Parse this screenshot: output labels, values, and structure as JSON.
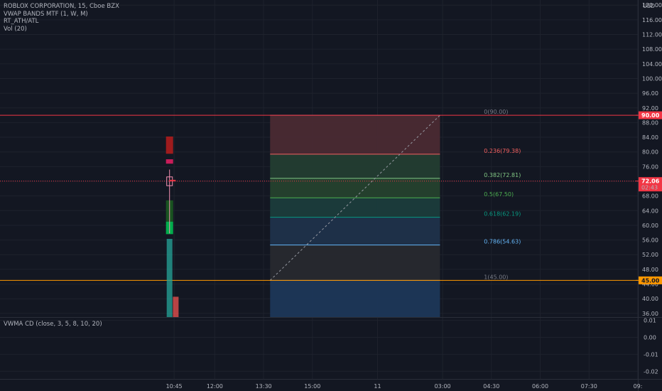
{
  "chart_data": {
    "type": "candlestick",
    "legend": {
      "title": "ROBLOX CORPORATION, 15, Cboe BZX",
      "indicators": [
        "VWAP BANDS MTF (1, W, M)",
        "RT_ATH/ATL",
        "Vol (20)"
      ]
    },
    "oscillator_label": "VWMA CD (close, 3, 5, 8, 10, 20)",
    "currency": "USD",
    "price_ticks": [
      "120.00",
      "116.00",
      "112.00",
      "108.00",
      "104.00",
      "100.00",
      "96.00",
      "92.00",
      "88.00",
      "84.00",
      "80.00",
      "76.00",
      "72.00",
      "68.00",
      "64.00",
      "60.00",
      "56.00",
      "52.00",
      "48.00",
      "44.00",
      "40.00",
      "36.00"
    ],
    "price_tick_values": [
      120,
      116,
      112,
      108,
      104,
      100,
      96,
      92,
      88,
      84,
      80,
      76,
      72,
      68,
      64,
      60,
      56,
      52,
      48,
      44,
      40,
      36
    ],
    "ylim": [
      35,
      121.4
    ],
    "osc_ticks": [
      "0.01",
      "0.00",
      "-0.01",
      "-0.02"
    ],
    "osc_tick_values": [
      0.01,
      0.0,
      -0.01,
      -0.02
    ],
    "osc_ylim": [
      -0.0245,
      0.0115
    ],
    "time_ticks": [
      "10:45",
      "12:00",
      "13:30",
      "15:00",
      "11",
      "03:00",
      "04:30",
      "06:00",
      "07:30",
      "09:"
    ],
    "time_tick_values": [
      0,
      1.25,
      2.75,
      4.25,
      6.25,
      8.25,
      9.75,
      11.25,
      12.75,
      14.25
    ],
    "time_unit": "hours since 10:45",
    "xlim": [
      -5.35,
      14.25
    ],
    "horizontal_lines": [
      {
        "price": 90.0,
        "color": "#f23645"
      },
      {
        "price": 72.06,
        "color": "#f23645",
        "style": "dotted"
      },
      {
        "price": 45.0,
        "color": "#ff9800"
      }
    ],
    "badges": [
      {
        "price": 90.0,
        "text": "90.00",
        "bg": "#f23645",
        "fg": "#ffffff"
      },
      {
        "price": 72.06,
        "text": "72.06",
        "sub": "02:43",
        "bg": "#f23645",
        "fg": "#ffffff"
      },
      {
        "price": 45.0,
        "text": "45.00",
        "bg": "#ff9800",
        "fg": "#131722"
      }
    ],
    "candles": [
      {
        "t": -0.14,
        "o": 70.8,
        "h": 75.2,
        "l": 57.8,
        "c": 73.2
      },
      {
        "t": -0.05,
        "o": 72.3,
        "h": 72.5,
        "l": 72.0,
        "c": 72.06
      }
    ],
    "vwap_bands": [
      {
        "t": -0.14,
        "ranges": [
          [
            79.5,
            84.2
          ],
          [
            76.8,
            78.0
          ],
          [
            61.0,
            66.8
          ],
          [
            57.6,
            61.0
          ]
        ]
      }
    ],
    "volume_bars": [
      {
        "t": -0.14,
        "v": 1.0,
        "color": "#26a69a"
      },
      {
        "t": 0.05,
        "v": 0.26,
        "color": "#ef5350"
      }
    ],
    "fibonacci": {
      "t_start": 2.95,
      "t_end": 8.17,
      "price_start": 45.0,
      "price_end": 90.0,
      "levels": [
        {
          "ratio": "0",
          "price": 90.0,
          "label": "0(90.00)",
          "color": "#787b86",
          "fill": "#4a2a33"
        },
        {
          "ratio": "0.236",
          "price": 79.38,
          "label": "0.236(79.38)",
          "color": "#f2605f",
          "fill": "#233d32"
        },
        {
          "ratio": "0.382",
          "price": 72.81,
          "label": "0.382(72.81)",
          "color": "#81c784",
          "fill": "#25412e"
        },
        {
          "ratio": "0.5",
          "price": 67.5,
          "label": "0.5(67.50)",
          "color": "#4caf50",
          "fill": "#1b3c3c"
        },
        {
          "ratio": "0.618",
          "price": 62.19,
          "label": "0.618(62.19)",
          "color": "#089981",
          "fill": "#1f324b"
        },
        {
          "ratio": "0.786",
          "price": 54.63,
          "label": "0.786(54.63)",
          "color": "#64b5f6",
          "fill": "#27292f"
        },
        {
          "ratio": "1",
          "price": 45.0,
          "label": "1(45.00)",
          "color": "#787b86",
          "fill": "#1c3758"
        }
      ],
      "bottom_price": 35.0
    }
  }
}
